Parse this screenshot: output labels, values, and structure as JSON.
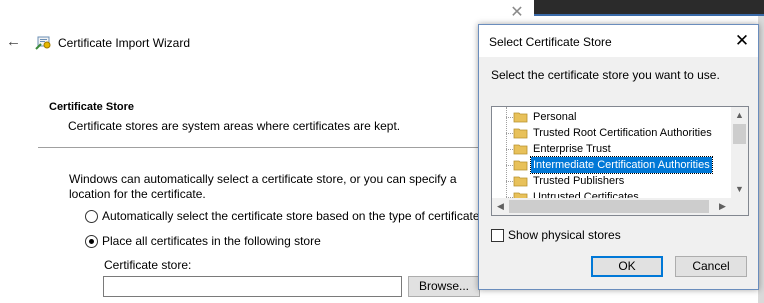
{
  "wizard": {
    "title": "Certificate Import Wizard",
    "section_heading": "Certificate Store",
    "section_desc": "Certificate stores are system areas where certificates are kept.",
    "paragraph": "Windows can automatically select a certificate store, or you can specify a location for the certificate.",
    "radio_auto_label": "Automatically select the certificate store based on the type of certificate",
    "radio_place_label": "Place all certificates in the following store",
    "radio_selected": "place",
    "store_label": "Certificate store:",
    "store_value": "",
    "browse_label": "Browse..."
  },
  "dialog": {
    "title": "Select Certificate Store",
    "prompt": "Select the certificate store you want to use.",
    "stores": [
      "Personal",
      "Trusted Root Certification Authorities",
      "Enterprise Trust",
      "Intermediate Certification Authorities",
      "Trusted Publishers",
      "Untrusted Certificates"
    ],
    "selected_store": "Intermediate Certification Authorities",
    "show_physical_label": "Show physical stores",
    "show_physical_checked": false,
    "ok_label": "OK",
    "cancel_label": "Cancel"
  },
  "colors": {
    "selection": "#0078d7",
    "folder": "#e8c15a"
  }
}
